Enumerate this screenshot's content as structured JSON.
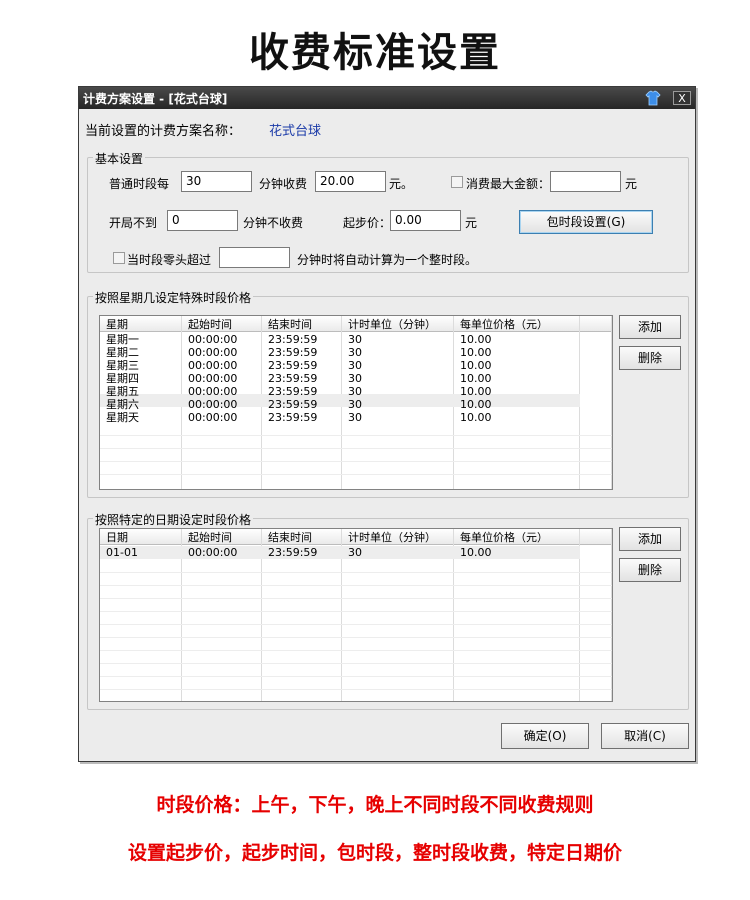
{
  "heading": "收费标准设置",
  "window": {
    "title": "计费方案设置 - [花式台球]",
    "close_label": "X"
  },
  "plan": {
    "label": "当前设置的计费方案名称：",
    "name": "花式台球"
  },
  "basic": {
    "title": "基本设置",
    "period_each": "普通时段每",
    "period_value": "30",
    "per_minute_fee": "分钟收费",
    "fee_value": "20.00",
    "yuan_dot": "元。",
    "max_label": "消费最大金额：",
    "max_value": "",
    "yuan": "元",
    "open_under": "开局不到",
    "open_value": "0",
    "no_charge": "分钟不收费",
    "start_price_label": "起步价：",
    "start_price_value": "0.00",
    "start_yuan": "元",
    "package_button": "包时段设置(G)",
    "remainder_label": "当时段零头超过",
    "remainder_value": "",
    "remainder_suffix": "分钟时将自动计算为一个整时段。"
  },
  "weekday": {
    "title": "按照星期几设定特殊时段价格",
    "headers": [
      "星期",
      "起始时间",
      "结束时间",
      "计时单位（分钟）",
      "每单位价格（元）"
    ],
    "rows": [
      [
        "星期一",
        "00:00:00",
        "23:59:59",
        "30",
        "10.00"
      ],
      [
        "星期二",
        "00:00:00",
        "23:59:59",
        "30",
        "10.00"
      ],
      [
        "星期三",
        "00:00:00",
        "23:59:59",
        "30",
        "10.00"
      ],
      [
        "星期四",
        "00:00:00",
        "23:59:59",
        "30",
        "10.00"
      ],
      [
        "星期五",
        "00:00:00",
        "23:59:59",
        "30",
        "10.00"
      ],
      [
        "星期六",
        "00:00:00",
        "23:59:59",
        "30",
        "10.00"
      ],
      [
        "星期天",
        "00:00:00",
        "23:59:59",
        "30",
        "10.00"
      ]
    ],
    "add": "添加",
    "delete": "删除"
  },
  "date": {
    "title": "按照特定的日期设定时段价格",
    "headers": [
      "日期",
      "起始时间",
      "结束时间",
      "计时单位（分钟）",
      "每单位价格（元）"
    ],
    "rows": [
      [
        "01-01",
        "00:00:00",
        "23:59:59",
        "30",
        "10.00"
      ]
    ],
    "add": "添加",
    "delete": "删除"
  },
  "footer": {
    "ok": "确定(O)",
    "cancel": "取消(C)"
  },
  "captions": {
    "line1": "时段价格：上午，下午，晚上不同时段不同收费规则",
    "line2": "设置起步价，起步时间，包时段，整时段收费，特定日期价"
  }
}
